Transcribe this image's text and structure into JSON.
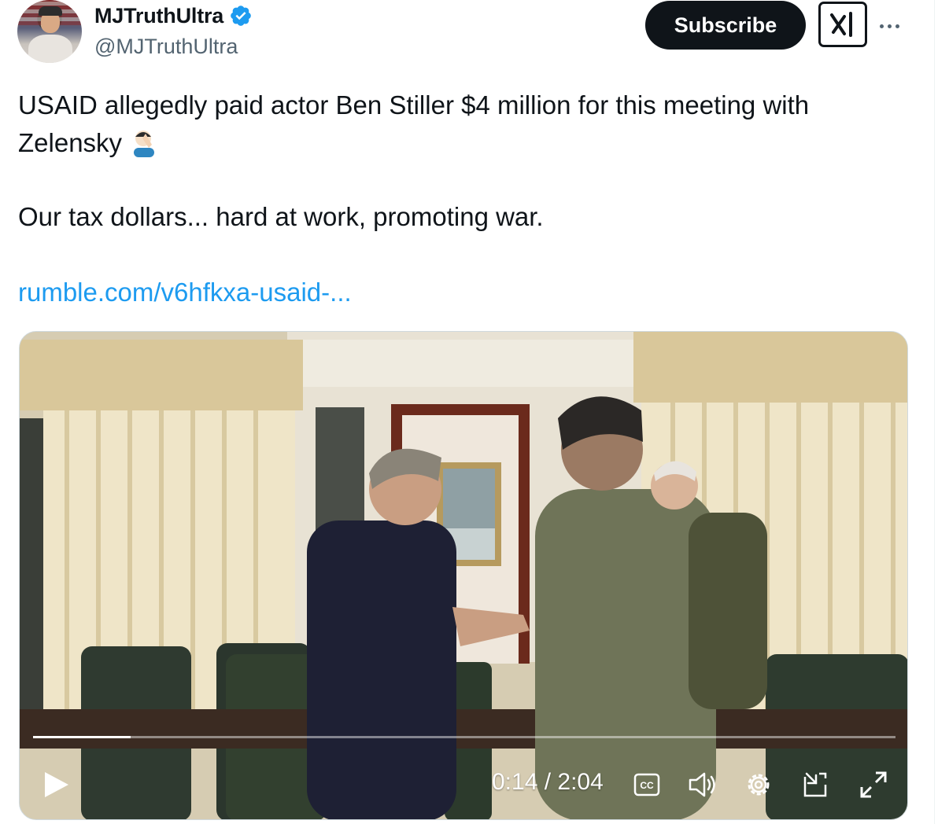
{
  "author": {
    "display_name": "MJTruthUltra",
    "handle": "@MJTruthUltra",
    "verified": true,
    "verified_color": "#1d9bf0"
  },
  "actions": {
    "subscribe_label": "Subscribe",
    "grok_icon": "grok-icon",
    "more_icon": "more-dots-icon"
  },
  "tweet": {
    "line1": "USAID allegedly paid actor Ben Stiller $4 million for this meeting with",
    "line2": "Zelensky",
    "line2_emoji": "facepalm-emoji",
    "line3": "Our tax dollars... hard at work, promoting war.",
    "link": "rumble.com/v6hfkxa-usaid-..."
  },
  "video": {
    "current_time": "0:14",
    "duration": "2:04",
    "time_display": "0:14 / 2:04",
    "progress_fraction": 0.113,
    "controls": [
      "play-icon",
      "captions-icon",
      "volume-icon",
      "settings-icon",
      "picture-in-picture-icon",
      "fullscreen-icon"
    ]
  },
  "colors": {
    "text": "#0f1419",
    "secondary_text": "#536471",
    "link": "#1d9bf0",
    "button_bg": "#0f1419"
  }
}
